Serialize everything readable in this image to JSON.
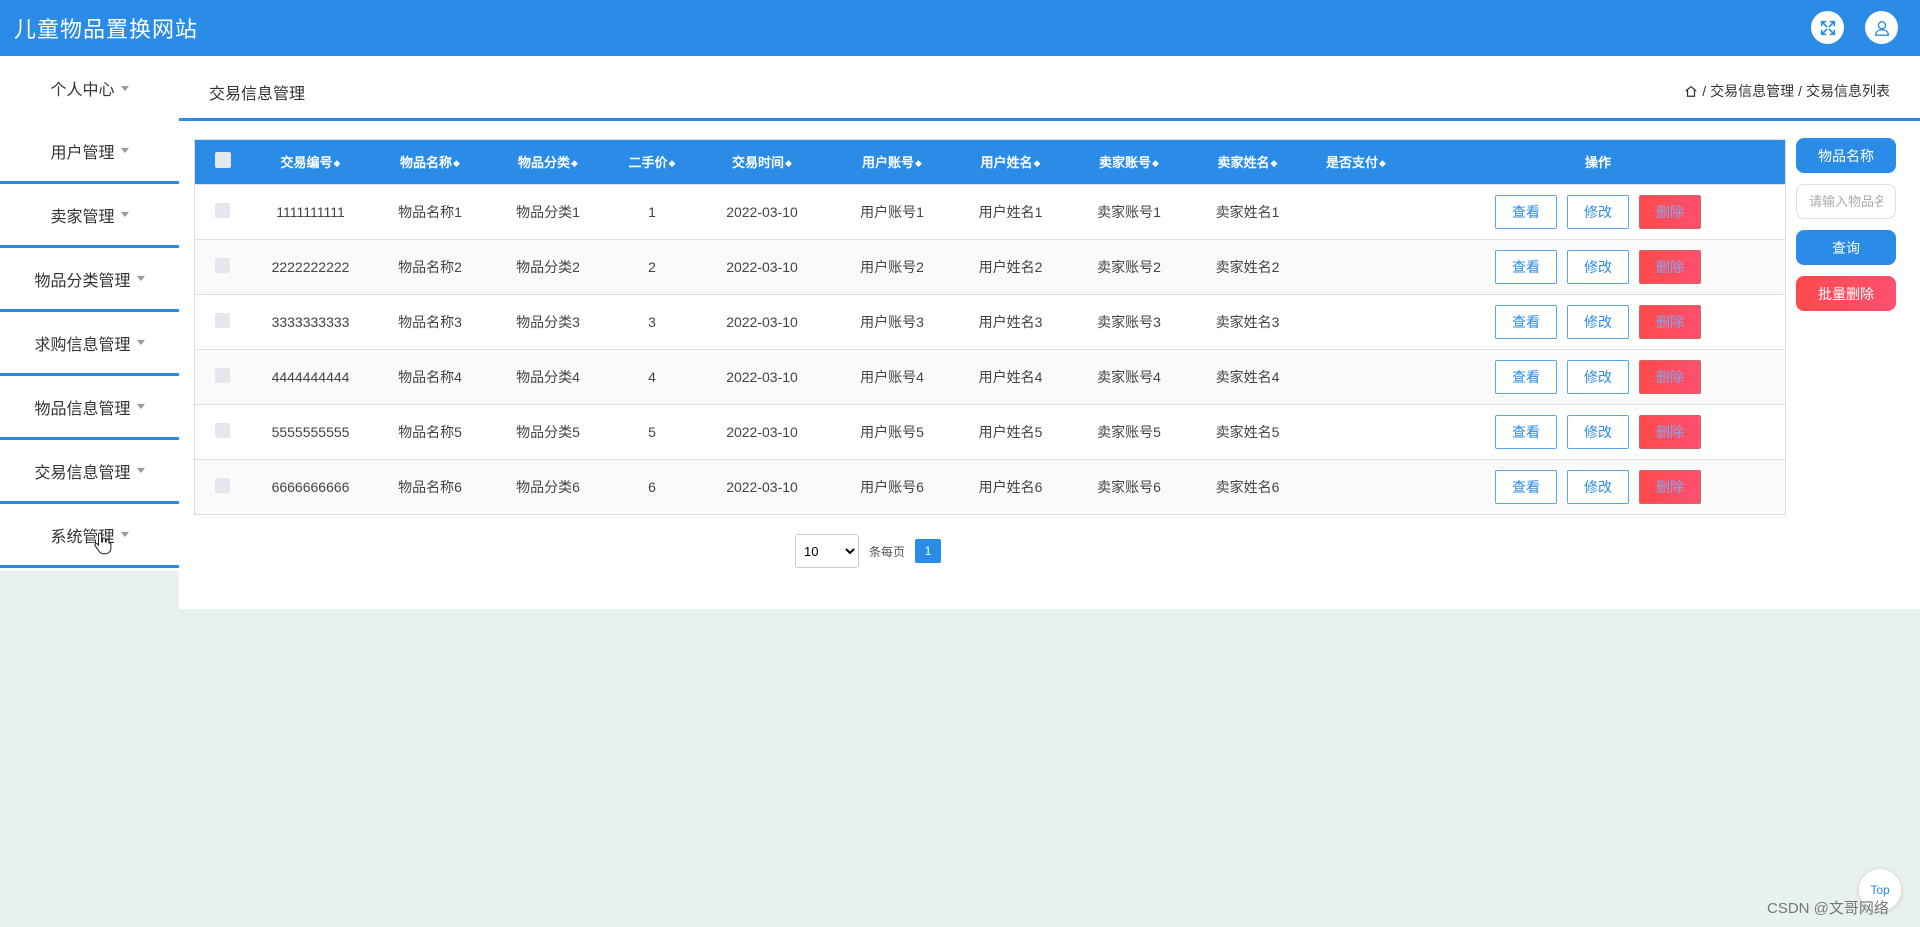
{
  "app": {
    "title": "儿童物品置换网站"
  },
  "header_icons": [
    "fullscreen-icon",
    "user-icon"
  ],
  "sidebar": {
    "items": [
      {
        "label": "个人中心"
      },
      {
        "label": "用户管理"
      },
      {
        "label": "卖家管理"
      },
      {
        "label": "物品分类管理"
      },
      {
        "label": "求购信息管理"
      },
      {
        "label": "物品信息管理"
      },
      {
        "label": "交易信息管理"
      },
      {
        "label": "系统管理"
      }
    ]
  },
  "main": {
    "page_title": "交易信息管理",
    "breadcrumb": [
      "交易信息管理",
      "交易信息列表"
    ],
    "breadcrumb_sep": "/"
  },
  "table": {
    "columns": [
      "交易编号",
      "物品名称",
      "物品分类",
      "二手价",
      "交易时间",
      "用户账号",
      "用户姓名",
      "卖家账号",
      "卖家姓名",
      "是否支付",
      "操作"
    ],
    "rows": [
      [
        "1111111111",
        "物品名称1",
        "物品分类1",
        "1",
        "2022-03-10",
        "用户账号1",
        "用户姓名1",
        "卖家账号1",
        "卖家姓名1",
        ""
      ],
      [
        "2222222222",
        "物品名称2",
        "物品分类2",
        "2",
        "2022-03-10",
        "用户账号2",
        "用户姓名2",
        "卖家账号2",
        "卖家姓名2",
        ""
      ],
      [
        "3333333333",
        "物品名称3",
        "物品分类3",
        "3",
        "2022-03-10",
        "用户账号3",
        "用户姓名3",
        "卖家账号3",
        "卖家姓名3",
        ""
      ],
      [
        "4444444444",
        "物品名称4",
        "物品分类4",
        "4",
        "2022-03-10",
        "用户账号4",
        "用户姓名4",
        "卖家账号4",
        "卖家姓名4",
        ""
      ],
      [
        "5555555555",
        "物品名称5",
        "物品分类5",
        "5",
        "2022-03-10",
        "用户账号5",
        "用户姓名5",
        "卖家账号5",
        "卖家姓名5",
        ""
      ],
      [
        "6666666666",
        "物品名称6",
        "物品分类6",
        "6",
        "2022-03-10",
        "用户账号6",
        "用户姓名6",
        "卖家账号6",
        "卖家姓名6",
        ""
      ]
    ],
    "actions": {
      "view": "查看",
      "edit": "修改",
      "delete": "删除"
    }
  },
  "pagination": {
    "page_size": "10",
    "page_size_options": [
      "10"
    ],
    "per_page_label": "条每页",
    "current_page": "1"
  },
  "search": {
    "field_label": "物品名称",
    "placeholder": "请输入物品名称",
    "query_button": "查询",
    "batch_delete_button": "批量删除"
  },
  "footer": {
    "top_button": "Top",
    "watermark": "CSDN @文哥网络"
  },
  "colors": {
    "primary": "#2a8ce6",
    "danger": "#ff4a4a",
    "background": "#e8f1ec"
  }
}
